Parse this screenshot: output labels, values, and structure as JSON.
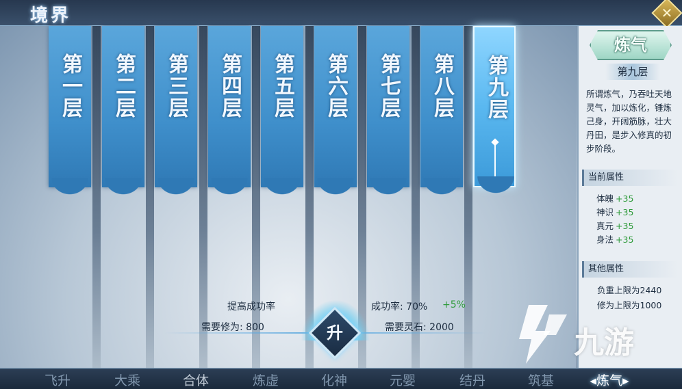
{
  "header": {
    "title": "境界",
    "close_icon": "close-x-icon"
  },
  "tiers": [
    {
      "label": "第一层",
      "active": false
    },
    {
      "label": "第二层",
      "active": false
    },
    {
      "label": "第三层",
      "active": false
    },
    {
      "label": "第四层",
      "active": false
    },
    {
      "label": "第五层",
      "active": false
    },
    {
      "label": "第六层",
      "active": false
    },
    {
      "label": "第七层",
      "active": false
    },
    {
      "label": "第八层",
      "active": false
    },
    {
      "label": "第九层",
      "active": true
    }
  ],
  "upgrade": {
    "improve_label": "提高成功率",
    "success_label": "成功率: 70%",
    "success_bonus": "+5%",
    "cultivation_label": "需要修为: 800",
    "stone_label": "需要灵石: 2000",
    "button_label": "升"
  },
  "side_panel": {
    "realm_name": "炼气",
    "current_layer": "第九层",
    "description": "所谓炼气，乃吞吐天地灵气，加以炼化，锤炼己身，开阔筋脉，壮大丹田，是步入修真的初步阶段。",
    "current_attrs_title": "当前属性",
    "attributes": [
      {
        "name": "体魄",
        "value": "+35"
      },
      {
        "name": "神识",
        "value": "+35"
      },
      {
        "name": "真元",
        "value": "+35"
      },
      {
        "name": "身法",
        "value": "+35"
      }
    ],
    "other_attrs_title": "其他属性",
    "other_attrs": [
      "负重上限为2440",
      "修为上限为1000"
    ]
  },
  "tabs": [
    {
      "label": "飞升",
      "state": "dim"
    },
    {
      "label": "大乘",
      "state": "dim"
    },
    {
      "label": "合体",
      "state": "mid"
    },
    {
      "label": "炼虚",
      "state": "dim"
    },
    {
      "label": "化神",
      "state": "dim"
    },
    {
      "label": "元婴",
      "state": "dim"
    },
    {
      "label": "结丹",
      "state": "dim"
    },
    {
      "label": "筑基",
      "state": "dim"
    },
    {
      "label": "炼气",
      "state": "active"
    }
  ],
  "watermark": {
    "text": "九游"
  },
  "colors": {
    "banner": "#3f8fcb",
    "banner_active": "#5ab8f0",
    "bonus_green": "#2f9b3b",
    "gold": "#d9b85a"
  }
}
